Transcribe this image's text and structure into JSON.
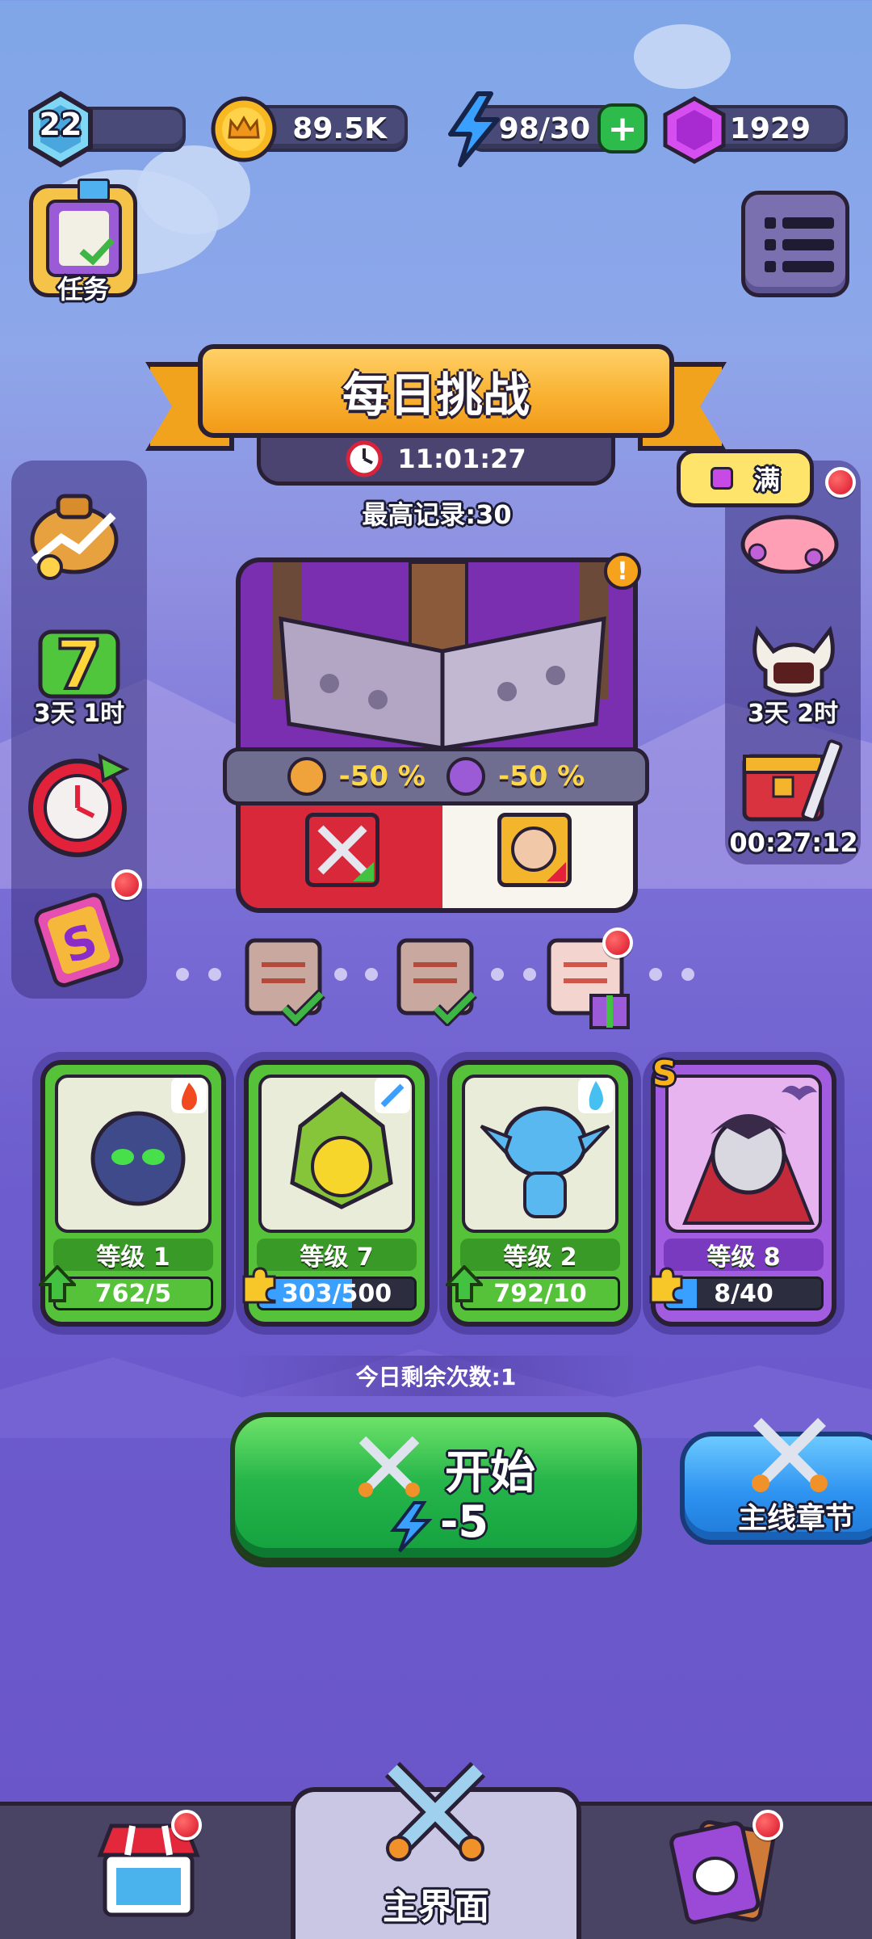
{
  "top_bar": {
    "level": "22",
    "gold": "89.5K",
    "energy": "98/30",
    "gems": "1929"
  },
  "quests": {
    "label": "任务"
  },
  "left_side": {
    "event_timer": "3天 1时"
  },
  "right_side": {
    "piggy_label": "满",
    "event_timer": "3天 2时",
    "chest_timer": "00:27:12"
  },
  "challenge": {
    "title": "每日挑战",
    "countdown": "11:01:27",
    "best_record": "最高记录:30",
    "bonus_1": "-50 %",
    "bonus_2": "-50 %"
  },
  "heroes": [
    {
      "level": "等级 1",
      "progress": "762/5",
      "progress_fraction": 1.0,
      "element": "fire"
    },
    {
      "level": "等级 7",
      "progress": "303/500",
      "progress_fraction": 0.6,
      "element": "sword"
    },
    {
      "level": "等级 2",
      "progress": "792/10",
      "progress_fraction": 1.0,
      "element": "water"
    },
    {
      "level": "等级 8",
      "progress": "8/40",
      "progress_fraction": 0.2,
      "element": "bat",
      "rank": "S"
    }
  ],
  "remaining": "今日剩余次数:1",
  "start": {
    "label": "开始",
    "cost": "-5"
  },
  "chapter": {
    "label": "主线章节"
  },
  "bottom_nav": {
    "home_label": "主界面"
  },
  "colors": {
    "green_card": "#55c23a",
    "purple_card": "#a25ce0",
    "gold": "#f9b233",
    "red_dot": "#d8142a"
  }
}
